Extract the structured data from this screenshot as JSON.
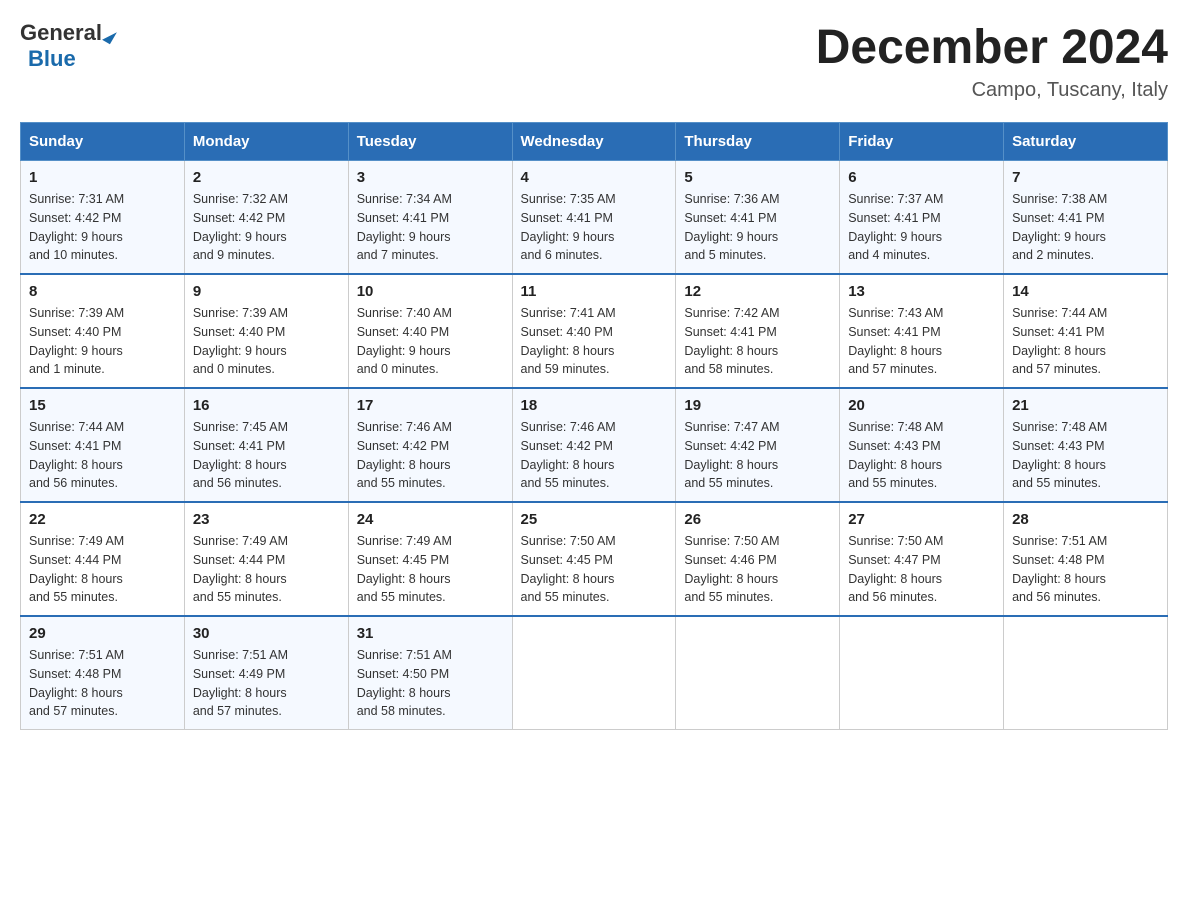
{
  "header": {
    "logo_general": "General",
    "logo_blue": "Blue",
    "month_title": "December 2024",
    "location": "Campo, Tuscany, Italy"
  },
  "days_of_week": [
    "Sunday",
    "Monday",
    "Tuesday",
    "Wednesday",
    "Thursday",
    "Friday",
    "Saturday"
  ],
  "weeks": [
    [
      {
        "day": "1",
        "sunrise": "7:31 AM",
        "sunset": "4:42 PM",
        "daylight": "9 hours and 10 minutes."
      },
      {
        "day": "2",
        "sunrise": "7:32 AM",
        "sunset": "4:42 PM",
        "daylight": "9 hours and 9 minutes."
      },
      {
        "day": "3",
        "sunrise": "7:34 AM",
        "sunset": "4:41 PM",
        "daylight": "9 hours and 7 minutes."
      },
      {
        "day": "4",
        "sunrise": "7:35 AM",
        "sunset": "4:41 PM",
        "daylight": "9 hours and 6 minutes."
      },
      {
        "day": "5",
        "sunrise": "7:36 AM",
        "sunset": "4:41 PM",
        "daylight": "9 hours and 5 minutes."
      },
      {
        "day": "6",
        "sunrise": "7:37 AM",
        "sunset": "4:41 PM",
        "daylight": "9 hours and 4 minutes."
      },
      {
        "day": "7",
        "sunrise": "7:38 AM",
        "sunset": "4:41 PM",
        "daylight": "9 hours and 2 minutes."
      }
    ],
    [
      {
        "day": "8",
        "sunrise": "7:39 AM",
        "sunset": "4:40 PM",
        "daylight": "9 hours and 1 minute."
      },
      {
        "day": "9",
        "sunrise": "7:39 AM",
        "sunset": "4:40 PM",
        "daylight": "9 hours and 0 minutes."
      },
      {
        "day": "10",
        "sunrise": "7:40 AM",
        "sunset": "4:40 PM",
        "daylight": "9 hours and 0 minutes."
      },
      {
        "day": "11",
        "sunrise": "7:41 AM",
        "sunset": "4:40 PM",
        "daylight": "8 hours and 59 minutes."
      },
      {
        "day": "12",
        "sunrise": "7:42 AM",
        "sunset": "4:41 PM",
        "daylight": "8 hours and 58 minutes."
      },
      {
        "day": "13",
        "sunrise": "7:43 AM",
        "sunset": "4:41 PM",
        "daylight": "8 hours and 57 minutes."
      },
      {
        "day": "14",
        "sunrise": "7:44 AM",
        "sunset": "4:41 PM",
        "daylight": "8 hours and 57 minutes."
      }
    ],
    [
      {
        "day": "15",
        "sunrise": "7:44 AM",
        "sunset": "4:41 PM",
        "daylight": "8 hours and 56 minutes."
      },
      {
        "day": "16",
        "sunrise": "7:45 AM",
        "sunset": "4:41 PM",
        "daylight": "8 hours and 56 minutes."
      },
      {
        "day": "17",
        "sunrise": "7:46 AM",
        "sunset": "4:42 PM",
        "daylight": "8 hours and 55 minutes."
      },
      {
        "day": "18",
        "sunrise": "7:46 AM",
        "sunset": "4:42 PM",
        "daylight": "8 hours and 55 minutes."
      },
      {
        "day": "19",
        "sunrise": "7:47 AM",
        "sunset": "4:42 PM",
        "daylight": "8 hours and 55 minutes."
      },
      {
        "day": "20",
        "sunrise": "7:48 AM",
        "sunset": "4:43 PM",
        "daylight": "8 hours and 55 minutes."
      },
      {
        "day": "21",
        "sunrise": "7:48 AM",
        "sunset": "4:43 PM",
        "daylight": "8 hours and 55 minutes."
      }
    ],
    [
      {
        "day": "22",
        "sunrise": "7:49 AM",
        "sunset": "4:44 PM",
        "daylight": "8 hours and 55 minutes."
      },
      {
        "day": "23",
        "sunrise": "7:49 AM",
        "sunset": "4:44 PM",
        "daylight": "8 hours and 55 minutes."
      },
      {
        "day": "24",
        "sunrise": "7:49 AM",
        "sunset": "4:45 PM",
        "daylight": "8 hours and 55 minutes."
      },
      {
        "day": "25",
        "sunrise": "7:50 AM",
        "sunset": "4:45 PM",
        "daylight": "8 hours and 55 minutes."
      },
      {
        "day": "26",
        "sunrise": "7:50 AM",
        "sunset": "4:46 PM",
        "daylight": "8 hours and 55 minutes."
      },
      {
        "day": "27",
        "sunrise": "7:50 AM",
        "sunset": "4:47 PM",
        "daylight": "8 hours and 56 minutes."
      },
      {
        "day": "28",
        "sunrise": "7:51 AM",
        "sunset": "4:48 PM",
        "daylight": "8 hours and 56 minutes."
      }
    ],
    [
      {
        "day": "29",
        "sunrise": "7:51 AM",
        "sunset": "4:48 PM",
        "daylight": "8 hours and 57 minutes."
      },
      {
        "day": "30",
        "sunrise": "7:51 AM",
        "sunset": "4:49 PM",
        "daylight": "8 hours and 57 minutes."
      },
      {
        "day": "31",
        "sunrise": "7:51 AM",
        "sunset": "4:50 PM",
        "daylight": "8 hours and 58 minutes."
      },
      null,
      null,
      null,
      null
    ]
  ],
  "labels": {
    "sunrise_prefix": "Sunrise: ",
    "sunset_prefix": "Sunset: ",
    "daylight_prefix": "Daylight: "
  }
}
